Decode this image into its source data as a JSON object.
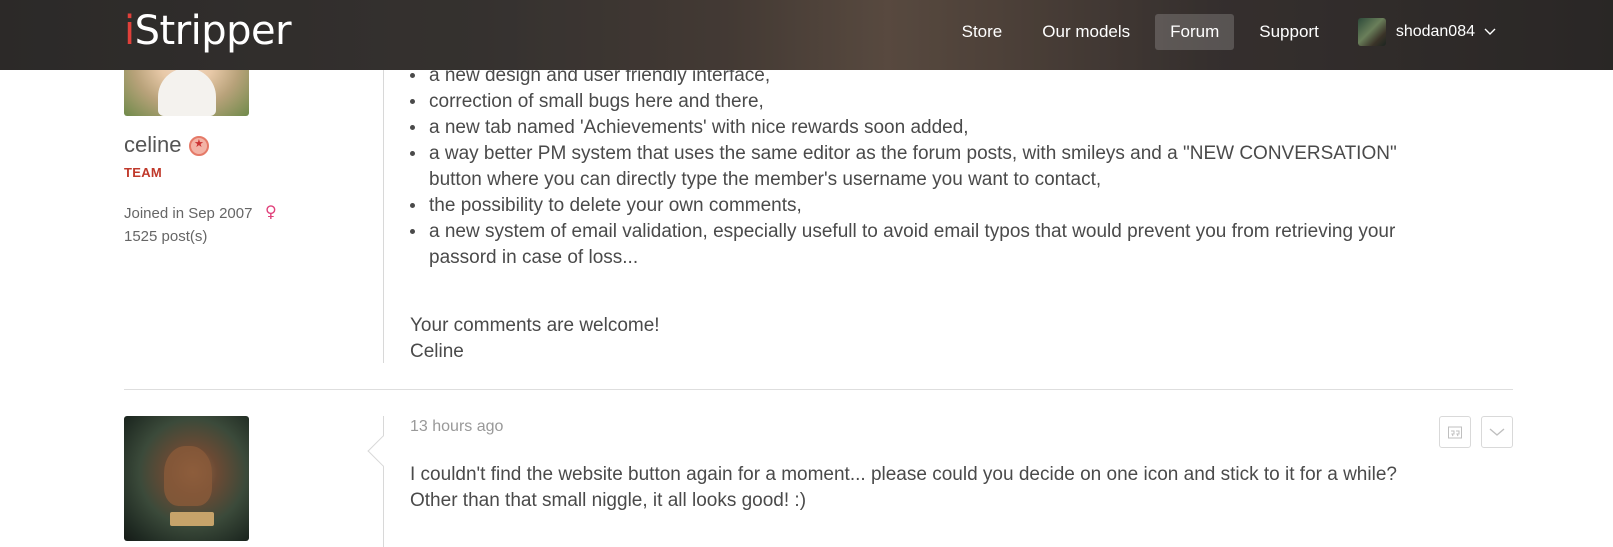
{
  "header": {
    "logo_i": "i",
    "logo_rest": "Stripper",
    "nav": [
      "Store",
      "Our models",
      "Forum",
      "Support"
    ],
    "active_nav": "Forum",
    "username": "shodan084"
  },
  "post1": {
    "author": "celine",
    "role": "TEAM",
    "joined": "Joined in Sep 2007",
    "posts": "1525 post(s)",
    "bullets": [
      "a new design and user friendly interface,",
      "correction of small bugs here and there,",
      "a new tab named 'Achievements' with nice rewards soon added,",
      "a way better PM system that uses the same editor as the forum posts, with smileys and a \"NEW CONVERSATION\" button where you can directly type the member's username you want to contact,",
      "the possibility to delete your own comments,",
      "a new system of email validation, especially usefull to avoid email typos that would prevent you from retrieving your passord in case of loss..."
    ],
    "closing_line1": "Your comments are welcome!",
    "closing_line2": "Celine"
  },
  "post2": {
    "time": "13 hours ago",
    "text": "I couldn't find the website button again for a moment... please could you decide on one icon and stick to it for a while? Other than that small niggle, it all looks good! :)"
  },
  "icons": {
    "female": "female-symbol-icon",
    "badge": "star-badge-icon",
    "quote": "quote-icon",
    "menu": "chevron-down-icon"
  },
  "colors": {
    "accent_red": "#c0392b",
    "logo_red": "#e0403a",
    "female_pink": "#e0407a"
  }
}
